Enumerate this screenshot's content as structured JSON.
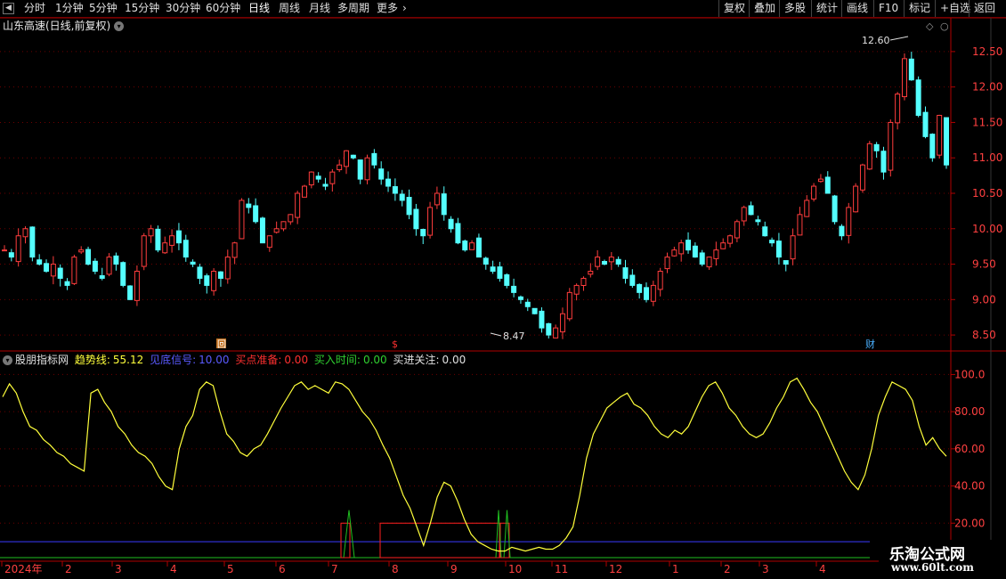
{
  "toolbar": {
    "periods": [
      "分时",
      "1分钟",
      "5分钟",
      "15分钟",
      "30分钟",
      "60分钟",
      "日线",
      "周线",
      "月线",
      "多周期",
      "更多"
    ],
    "active_period": "日线",
    "right_buttons": [
      "复权",
      "叠加",
      "多股",
      "统计",
      "画线",
      "F10",
      "标记",
      "+自选",
      "返回"
    ]
  },
  "stock": {
    "title": "山东高速(日线,前复权)",
    "high_label": "12.60",
    "low_label": "8.47"
  },
  "price_axis": {
    "ticks": [
      "12.50",
      "12.00",
      "11.50",
      "11.00",
      "10.50",
      "10.00",
      "9.50",
      "9.00",
      "8.50"
    ]
  },
  "markers": {
    "m1": "回",
    "m2": "$",
    "m3": "财"
  },
  "indicator": {
    "name": "股朋指标网",
    "trend_label": "趋势线:",
    "trend_value": "55.12",
    "bottom_label": "见底信号:",
    "bottom_value": "10.00",
    "ready_label": "买点准备:",
    "ready_value": "0.00",
    "buytime_label": "买入时间:",
    "buytime_value": "0.00",
    "attention_label": "买进关注:",
    "attention_value": "0.00",
    "ticks": [
      "100.0",
      "80.00",
      "60.00",
      "40.00",
      "20.00"
    ]
  },
  "date_axis": {
    "labels": [
      "2024年",
      "2",
      "3",
      "4",
      "5",
      "6",
      "7",
      "8",
      "9",
      "10",
      "11",
      "12",
      "1",
      "2",
      "3",
      "4"
    ]
  },
  "watermark": {
    "line1": "乐淘公式网",
    "line2": "www.60lt.com"
  },
  "colors": {
    "up": "#ff3d3d",
    "down": "#54ffff",
    "trend": "#ffff3b",
    "blue_line": "#3a3aff",
    "red_box": "#ff2020",
    "green_line": "#20c020",
    "grid": "#6e0000",
    "axis": "#b00000"
  },
  "chart_data": [
    {
      "type": "candlestick",
      "ylim": [
        8.3,
        12.75
      ],
      "close_series": [
        9.7,
        9.6,
        9.9,
        10.0,
        9.6,
        9.5,
        9.4,
        9.5,
        9.3,
        9.2,
        9.6,
        9.7,
        9.5,
        9.4,
        9.3,
        9.6,
        9.5,
        9.2,
        9.0,
        9.4,
        9.9,
        10.0,
        9.7,
        9.8,
        9.9,
        9.8,
        9.6,
        9.5,
        9.3,
        9.2,
        9.4,
        9.3,
        9.6,
        9.8,
        10.4,
        10.3,
        10.1,
        9.8,
        9.9,
        10.0,
        10.1,
        10.2,
        10.5,
        10.6,
        10.8,
        10.7,
        10.6,
        10.8,
        10.9,
        11.1,
        11.0,
        10.7,
        11.0,
        10.9,
        10.7,
        10.6,
        10.5,
        10.4,
        10.2,
        10.0,
        9.9,
        10.3,
        10.5,
        10.2,
        10.0,
        9.8,
        9.7,
        9.8,
        9.6,
        9.5,
        9.4,
        9.3,
        9.2,
        9.1,
        9.0,
        8.9,
        8.8,
        8.6,
        8.5,
        8.6,
        8.8,
        9.1,
        9.2,
        9.3,
        9.4,
        9.6,
        9.5,
        9.6,
        9.5,
        9.3,
        9.2,
        9.1,
        9.0,
        9.2,
        9.4,
        9.6,
        9.7,
        9.8,
        9.7,
        9.6,
        9.5,
        9.6,
        9.7,
        9.8,
        9.9,
        10.1,
        10.3,
        10.2,
        10.1,
        9.9,
        9.8,
        9.6,
        9.5,
        9.9,
        10.2,
        10.4,
        10.6,
        10.7,
        10.5,
        10.1,
        9.9,
        10.3,
        10.6,
        10.9,
        11.2,
        11.1,
        10.8,
        11.5,
        11.9,
        12.4,
        12.1,
        11.6,
        11.3,
        11.0,
        11.6,
        10.9
      ]
    },
    {
      "type": "line",
      "ylim": [
        0,
        105
      ],
      "series": [
        {
          "name": "趋势线",
          "values": [
            88,
            95,
            90,
            80,
            72,
            70,
            65,
            62,
            58,
            56,
            52,
            50,
            48,
            90,
            92,
            85,
            80,
            72,
            68,
            62,
            58,
            56,
            52,
            45,
            40,
            38,
            60,
            72,
            78,
            92,
            96,
            94,
            80,
            68,
            64,
            58,
            56,
            60,
            62,
            68,
            75,
            82,
            88,
            94,
            96,
            92,
            94,
            92,
            90,
            96,
            95,
            92,
            86,
            80,
            76,
            70,
            62,
            55,
            45,
            35,
            28,
            18,
            8,
            20,
            34,
            42,
            40,
            32,
            22,
            14,
            10,
            8,
            6,
            5,
            5,
            7,
            6,
            5,
            6,
            7,
            6,
            6,
            8,
            12,
            18,
            35,
            55,
            68,
            75,
            82,
            85,
            88,
            90,
            84,
            82,
            78,
            72,
            68,
            66,
            70,
            68,
            72,
            80,
            88,
            94,
            96,
            90,
            82,
            78,
            72,
            68,
            66,
            68,
            74,
            82,
            88,
            96,
            98,
            92,
            85,
            80,
            72,
            64,
            56,
            48,
            42,
            38,
            46,
            60,
            78,
            88,
            96,
            94,
            92,
            86,
            72,
            62,
            66,
            60,
            56
          ]
        }
      ],
      "bottom_signal": 10,
      "buy_ready_box": [
        0,
        20
      ]
    }
  ]
}
